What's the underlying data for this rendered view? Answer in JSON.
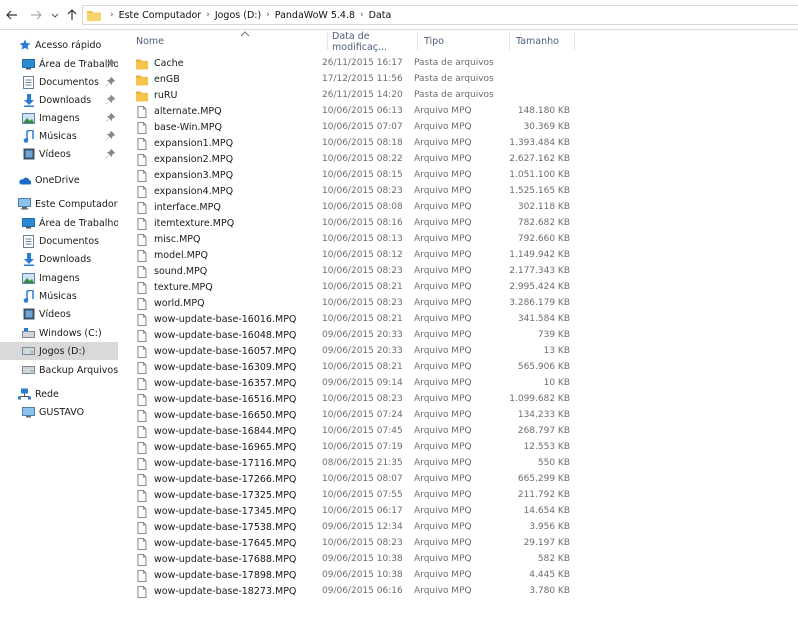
{
  "address": {
    "breadcrumbs": [
      "Este Computador",
      "Jogos (D:)",
      "PandaWoW 5.4.8",
      "Data"
    ]
  },
  "sidebar": {
    "items": [
      {
        "label": "Acesso rápido",
        "icon": "star-icon",
        "pinned": false
      },
      {
        "label": "Área de Trabalho",
        "icon": "desktop-icon",
        "pinned": true
      },
      {
        "label": "Documentos",
        "icon": "documents-icon",
        "pinned": true
      },
      {
        "label": "Downloads",
        "icon": "downloads-icon",
        "pinned": true
      },
      {
        "label": "Imagens",
        "icon": "pictures-icon",
        "pinned": true
      },
      {
        "label": "Músicas",
        "icon": "music-icon",
        "pinned": true
      },
      {
        "label": "Vídeos",
        "icon": "videos-icon",
        "pinned": true
      },
      {
        "label": "OneDrive",
        "icon": "onedrive-icon",
        "pinned": false
      },
      {
        "label": "Este Computador",
        "icon": "computer-icon",
        "pinned": false
      },
      {
        "label": "Área de Trabalho",
        "icon": "desktop-icon",
        "pinned": false
      },
      {
        "label": "Documentos",
        "icon": "documents-icon",
        "pinned": false
      },
      {
        "label": "Downloads",
        "icon": "downloads-icon",
        "pinned": false
      },
      {
        "label": "Imagens",
        "icon": "pictures-icon",
        "pinned": false
      },
      {
        "label": "Músicas",
        "icon": "music-icon",
        "pinned": false
      },
      {
        "label": "Vídeos",
        "icon": "videos-icon",
        "pinned": false
      },
      {
        "label": "Windows (C:)",
        "icon": "windows-drive-icon",
        "pinned": false
      },
      {
        "label": "Jogos (D:)",
        "icon": "drive-icon",
        "pinned": false,
        "selected": true
      },
      {
        "label": "Backup Arquivos (E",
        "icon": "drive-icon",
        "pinned": false
      },
      {
        "label": "Rede",
        "icon": "network-icon",
        "pinned": false
      },
      {
        "label": "GUSTAVO",
        "icon": "network-computer-icon",
        "pinned": false
      }
    ]
  },
  "columns": {
    "name": "Nome",
    "date": "Data de modificaç...",
    "type": "Tipo",
    "size": "Tamanho"
  },
  "files": [
    {
      "name": "Cache",
      "date": "26/11/2015 16:17",
      "type": "Pasta de arquivos",
      "size": "",
      "kind": "folder"
    },
    {
      "name": "enGB",
      "date": "17/12/2015 11:56",
      "type": "Pasta de arquivos",
      "size": "",
      "kind": "folder"
    },
    {
      "name": "ruRU",
      "date": "26/11/2015 14:20",
      "type": "Pasta de arquivos",
      "size": "",
      "kind": "folder"
    },
    {
      "name": "alternate.MPQ",
      "date": "10/06/2015 06:13",
      "type": "Arquivo MPQ",
      "size": "148.180 KB",
      "kind": "file"
    },
    {
      "name": "base-Win.MPQ",
      "date": "10/06/2015 07:07",
      "type": "Arquivo MPQ",
      "size": "30.369 KB",
      "kind": "file"
    },
    {
      "name": "expansion1.MPQ",
      "date": "10/06/2015 08:18",
      "type": "Arquivo MPQ",
      "size": "1.393.484 KB",
      "kind": "file"
    },
    {
      "name": "expansion2.MPQ",
      "date": "10/06/2015 08:22",
      "type": "Arquivo MPQ",
      "size": "2.627.162 KB",
      "kind": "file"
    },
    {
      "name": "expansion3.MPQ",
      "date": "10/06/2015 08:15",
      "type": "Arquivo MPQ",
      "size": "1.051.100 KB",
      "kind": "file"
    },
    {
      "name": "expansion4.MPQ",
      "date": "10/06/2015 08:23",
      "type": "Arquivo MPQ",
      "size": "1.525.165 KB",
      "kind": "file"
    },
    {
      "name": "interface.MPQ",
      "date": "10/06/2015 08:08",
      "type": "Arquivo MPQ",
      "size": "302.118 KB",
      "kind": "file"
    },
    {
      "name": "itemtexture.MPQ",
      "date": "10/06/2015 08:16",
      "type": "Arquivo MPQ",
      "size": "782.682 KB",
      "kind": "file"
    },
    {
      "name": "misc.MPQ",
      "date": "10/06/2015 08:13",
      "type": "Arquivo MPQ",
      "size": "792.660 KB",
      "kind": "file"
    },
    {
      "name": "model.MPQ",
      "date": "10/06/2015 08:12",
      "type": "Arquivo MPQ",
      "size": "1.149.942 KB",
      "kind": "file"
    },
    {
      "name": "sound.MPQ",
      "date": "10/06/2015 08:23",
      "type": "Arquivo MPQ",
      "size": "2.177.343 KB",
      "kind": "file"
    },
    {
      "name": "texture.MPQ",
      "date": "10/06/2015 08:21",
      "type": "Arquivo MPQ",
      "size": "2.995.424 KB",
      "kind": "file"
    },
    {
      "name": "world.MPQ",
      "date": "10/06/2015 08:23",
      "type": "Arquivo MPQ",
      "size": "3.286.179 KB",
      "kind": "file"
    },
    {
      "name": "wow-update-base-16016.MPQ",
      "date": "10/06/2015 08:21",
      "type": "Arquivo MPQ",
      "size": "341.584 KB",
      "kind": "file"
    },
    {
      "name": "wow-update-base-16048.MPQ",
      "date": "09/06/2015 20:33",
      "type": "Arquivo MPQ",
      "size": "739 KB",
      "kind": "file"
    },
    {
      "name": "wow-update-base-16057.MPQ",
      "date": "09/06/2015 20:33",
      "type": "Arquivo MPQ",
      "size": "13 KB",
      "kind": "file"
    },
    {
      "name": "wow-update-base-16309.MPQ",
      "date": "10/06/2015 08:21",
      "type": "Arquivo MPQ",
      "size": "565.906 KB",
      "kind": "file"
    },
    {
      "name": "wow-update-base-16357.MPQ",
      "date": "09/06/2015 09:14",
      "type": "Arquivo MPQ",
      "size": "10 KB",
      "kind": "file"
    },
    {
      "name": "wow-update-base-16516.MPQ",
      "date": "10/06/2015 08:23",
      "type": "Arquivo MPQ",
      "size": "1.099.682 KB",
      "kind": "file"
    },
    {
      "name": "wow-update-base-16650.MPQ",
      "date": "10/06/2015 07:24",
      "type": "Arquivo MPQ",
      "size": "134.233 KB",
      "kind": "file"
    },
    {
      "name": "wow-update-base-16844.MPQ",
      "date": "10/06/2015 07:45",
      "type": "Arquivo MPQ",
      "size": "268.797 KB",
      "kind": "file"
    },
    {
      "name": "wow-update-base-16965.MPQ",
      "date": "10/06/2015 07:19",
      "type": "Arquivo MPQ",
      "size": "12.553 KB",
      "kind": "file"
    },
    {
      "name": "wow-update-base-17116.MPQ",
      "date": "08/06/2015 21:35",
      "type": "Arquivo MPQ",
      "size": "550 KB",
      "kind": "file"
    },
    {
      "name": "wow-update-base-17266.MPQ",
      "date": "10/06/2015 08:07",
      "type": "Arquivo MPQ",
      "size": "665.299 KB",
      "kind": "file"
    },
    {
      "name": "wow-update-base-17325.MPQ",
      "date": "10/06/2015 07:55",
      "type": "Arquivo MPQ",
      "size": "211.792 KB",
      "kind": "file"
    },
    {
      "name": "wow-update-base-17345.MPQ",
      "date": "10/06/2015 06:17",
      "type": "Arquivo MPQ",
      "size": "14.654 KB",
      "kind": "file"
    },
    {
      "name": "wow-update-base-17538.MPQ",
      "date": "09/06/2015 12:34",
      "type": "Arquivo MPQ",
      "size": "3.956 KB",
      "kind": "file"
    },
    {
      "name": "wow-update-base-17645.MPQ",
      "date": "10/06/2015 08:23",
      "type": "Arquivo MPQ",
      "size": "29.197 KB",
      "kind": "file"
    },
    {
      "name": "wow-update-base-17688.MPQ",
      "date": "09/06/2015 10:38",
      "type": "Arquivo MPQ",
      "size": "582 KB",
      "kind": "file"
    },
    {
      "name": "wow-update-base-17898.MPQ",
      "date": "09/06/2015 10:38",
      "type": "Arquivo MPQ",
      "size": "4.445 KB",
      "kind": "file"
    },
    {
      "name": "wow-update-base-18273.MPQ",
      "date": "09/06/2015 06:16",
      "type": "Arquivo MPQ",
      "size": "3.780 KB",
      "kind": "file"
    }
  ],
  "colors": {
    "accent": "#0078d7",
    "folder": "#f4c44c",
    "header_text": "#4c607a",
    "selection": "#d9d9d9"
  }
}
